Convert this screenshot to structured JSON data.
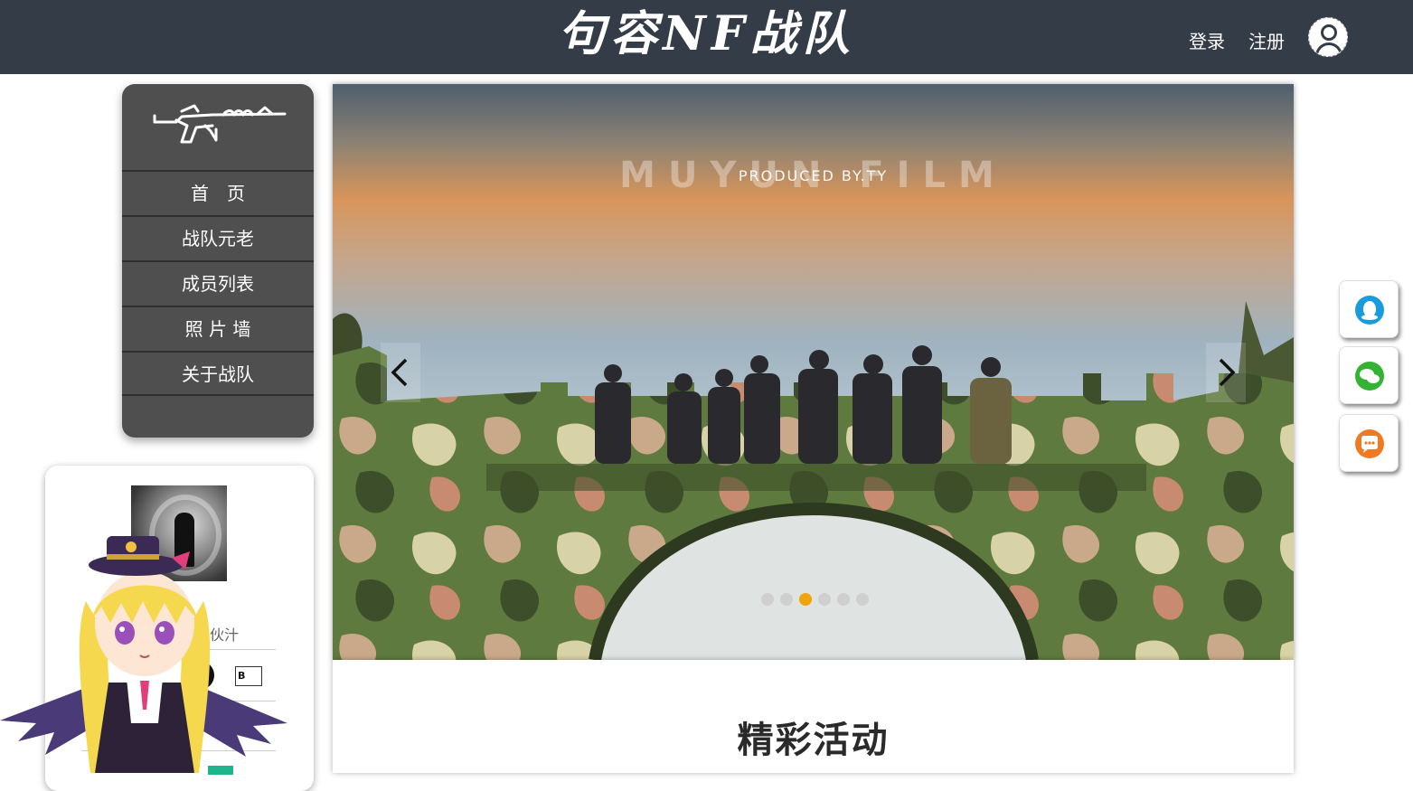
{
  "header": {
    "site_title": "句容NF战队",
    "login_label": "登录",
    "register_label": "注册"
  },
  "sidebar": {
    "items": [
      {
        "label": "首　页"
      },
      {
        "label": "战队元老"
      },
      {
        "label": "成员列表"
      },
      {
        "label": "照 片 墙"
      },
      {
        "label": "关于战队"
      }
    ]
  },
  "profile": {
    "text": "的小伙汁",
    "icons": [
      "round-icon",
      "blog-icon"
    ],
    "blog_icon_text": "B"
  },
  "banner": {
    "watermark": "MUYUN FILM",
    "credit": "PRODUCED BY.TY",
    "slide_count": 6,
    "active_slide": 3,
    "prev_icon": "chevron-left-icon",
    "next_icon": "chevron-right-icon"
  },
  "content": {
    "section_title": "精彩活动"
  },
  "float_buttons": [
    {
      "name": "qq",
      "icon": "qq-icon",
      "color": "#1a9bdc"
    },
    {
      "name": "wechat",
      "icon": "wechat-icon",
      "color": "#34b233"
    },
    {
      "name": "chat",
      "icon": "chat-icon",
      "color": "#f07a22"
    }
  ],
  "colors": {
    "header_bg": "#343c48",
    "sidebar_bg": "#4f4f4f",
    "dot_active": "#f0a30a"
  }
}
